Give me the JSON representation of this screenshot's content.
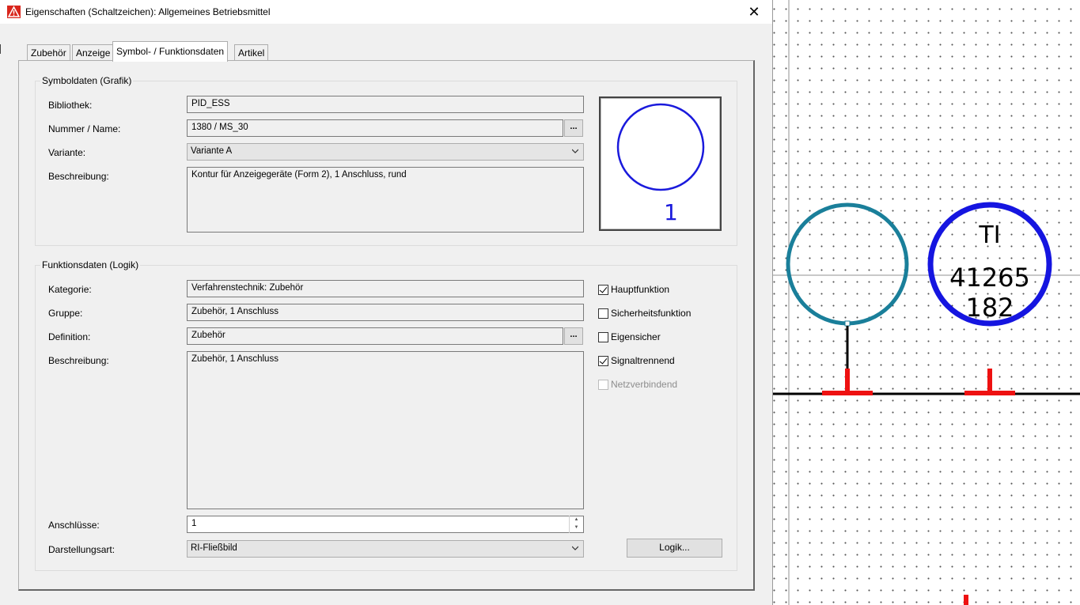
{
  "window": {
    "title": "Eigenschaften (Schaltzeichen): Allgemeines Betriebsmittel",
    "close_glyph": "✕",
    "app_icon": "warning-triangle-icon"
  },
  "tabs": [
    {
      "label": "Zubehör",
      "active": false
    },
    {
      "label": "Anzeige",
      "active": false
    },
    {
      "label": "Symbol- / Funktionsdaten",
      "active": true
    },
    {
      "label": "Artikel",
      "active": false
    }
  ],
  "symbol_group": {
    "title": "Symboldaten (Grafik)",
    "library_label": "Bibliothek:",
    "library_value": "PID_ESS",
    "number_label": "Nummer / Name:",
    "number_value": "1380 / MS_30",
    "browse_label": "...",
    "variant_label": "Variante:",
    "variant_value": "Variante A",
    "description_label": "Beschreibung:",
    "description_value": "Kontur für Anzeigegeräte (Form 2), 1 Anschluss, rund",
    "preview_number": "1"
  },
  "function_group": {
    "title": "Funktionsdaten (Logik)",
    "category_label": "Kategorie:",
    "category_value": "Verfahrenstechnik: Zubehör",
    "group_label": "Gruppe:",
    "group_value": "Zubehör, 1 Anschluss",
    "definition_label": "Definition:",
    "definition_value": "Zubehör",
    "browse_label": "...",
    "description_label": "Beschreibung:",
    "description_value": "Zubehör, 1 Anschluss",
    "connections_label": "Anschlüsse:",
    "connections_value": "1",
    "representation_label": "Darstellungsart:",
    "representation_value": "RI-Fließbild",
    "logic_button": "Logik...",
    "checkboxes": [
      {
        "label": "Hauptfunktion",
        "checked": true,
        "disabled": false
      },
      {
        "label": "Sicherheitsfunktion",
        "checked": false,
        "disabled": false
      },
      {
        "label": "Eigensicher",
        "checked": false,
        "disabled": false
      },
      {
        "label": "Signaltrennend",
        "checked": true,
        "disabled": false
      },
      {
        "label": "Netzverbindend",
        "checked": false,
        "disabled": true
      }
    ]
  },
  "canvas": {
    "ti_top": "TI",
    "ti_number": "41265",
    "ti_sub": "182",
    "colors": {
      "teal_circle": "#1a7f9a",
      "blue_circle": "#1515e0",
      "connector_red": "#ee1111"
    }
  }
}
